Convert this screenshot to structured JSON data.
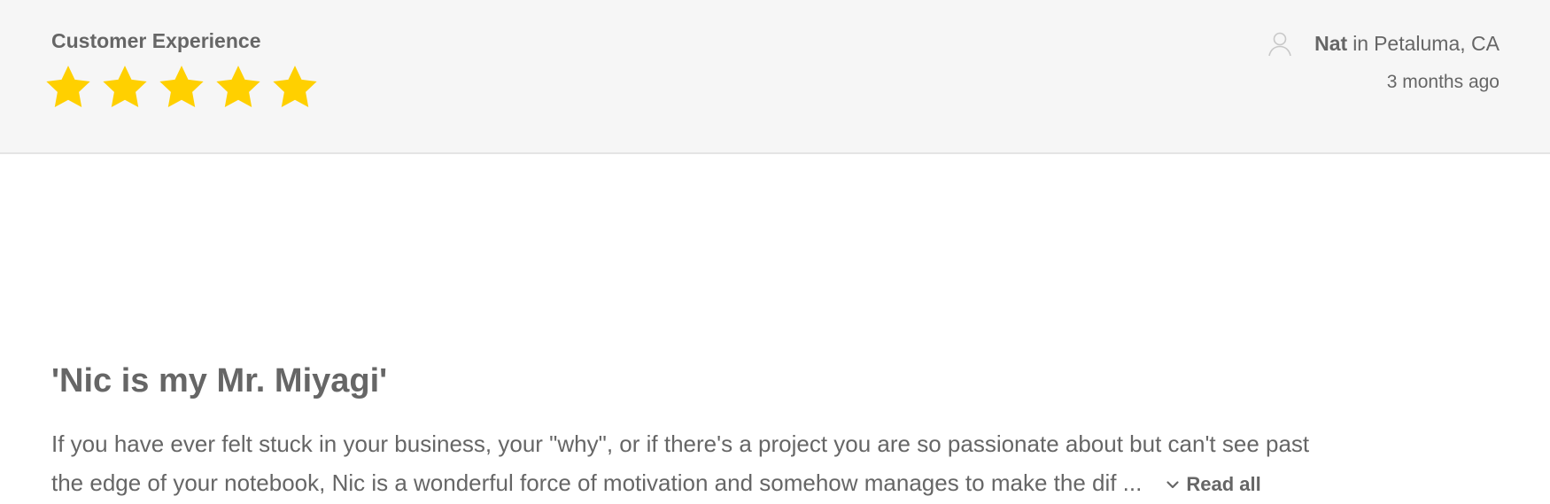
{
  "header": {
    "category": "Customer Experience",
    "rating": 5,
    "rating_max": 5,
    "star_color": "#ffd000",
    "reviewer": {
      "icon": "user-icon",
      "name": "Nat",
      "connector": "in",
      "location": "Petaluma, CA"
    },
    "timestamp": "3 months ago"
  },
  "review": {
    "title": "'Nic is my Mr. Miyagi'",
    "lines": [
      "If you have ever felt stuck in your business, your \"why\", or if there's a project you are so passionate about but can't see past",
      "the edge of your notebook, Nic is a wonderful force of motivation and somehow manages to make the dif ..."
    ],
    "read_all": {
      "icon": "chevron-down-icon",
      "label": "Read all"
    }
  }
}
